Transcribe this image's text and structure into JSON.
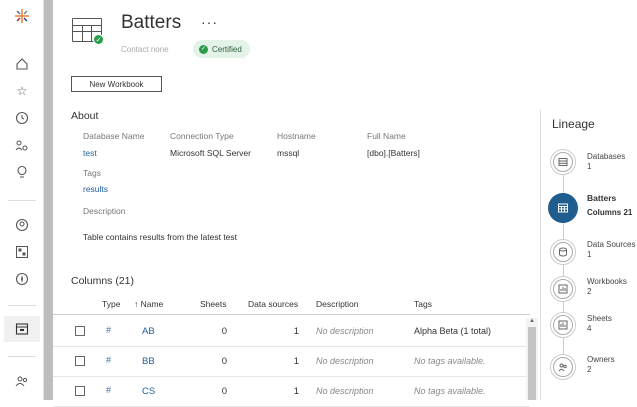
{
  "nav": {
    "icons": [
      "tableau-logo-icon",
      "home-icon",
      "star-icon",
      "recents-icon",
      "groups-icon",
      "bulb-icon",
      "user-icon",
      "dashboard-icon",
      "explore-icon",
      "data-source-icon",
      "users-icon"
    ]
  },
  "asset": {
    "title": "Batters",
    "more": "···",
    "contact_label": "Contact",
    "contact_value": "none",
    "certified": "Certified"
  },
  "new_workbook": "New Workbook",
  "about": {
    "heading": "About",
    "database_name_label": "Database Name",
    "database_name": "test",
    "connection_type_label": "Connection Type",
    "connection_type": "Microsoft SQL Server",
    "hostname_label": "Hostname",
    "hostname": "mssql",
    "full_name_label": "Full Name",
    "full_name": "[dbo].[Batters]",
    "tags_label": "Tags",
    "tags": "results",
    "description_label": "Description",
    "description": "Table contains results from the latest test"
  },
  "columns": {
    "heading": "Columns (21)",
    "headers": {
      "type": "Type",
      "name": "↑ Name",
      "sheets": "Sheets",
      "data_sources": "Data sources",
      "description": "Description",
      "tags": "Tags"
    },
    "rows": [
      {
        "type": "#",
        "name": "AB",
        "sheets": "0",
        "data_sources": "1",
        "description": "No description",
        "tags": "Alpha Beta  (1 total)"
      },
      {
        "type": "#",
        "name": "BB",
        "sheets": "0",
        "data_sources": "1",
        "description": "No description",
        "tags": "No tags available."
      },
      {
        "type": "#",
        "name": "CS",
        "sheets": "0",
        "data_sources": "1",
        "description": "No description",
        "tags": "No tags available."
      }
    ]
  },
  "lineage": {
    "title": "Lineage",
    "items": [
      {
        "label": "Databases",
        "count": "1"
      },
      {
        "label": "Batters",
        "count": "Columns 21"
      },
      {
        "label": "Data Sources",
        "count": "1"
      },
      {
        "label": "Workbooks",
        "count": "2"
      },
      {
        "label": "Sheets",
        "count": "4"
      },
      {
        "label": "Owners",
        "count": "2"
      }
    ]
  }
}
